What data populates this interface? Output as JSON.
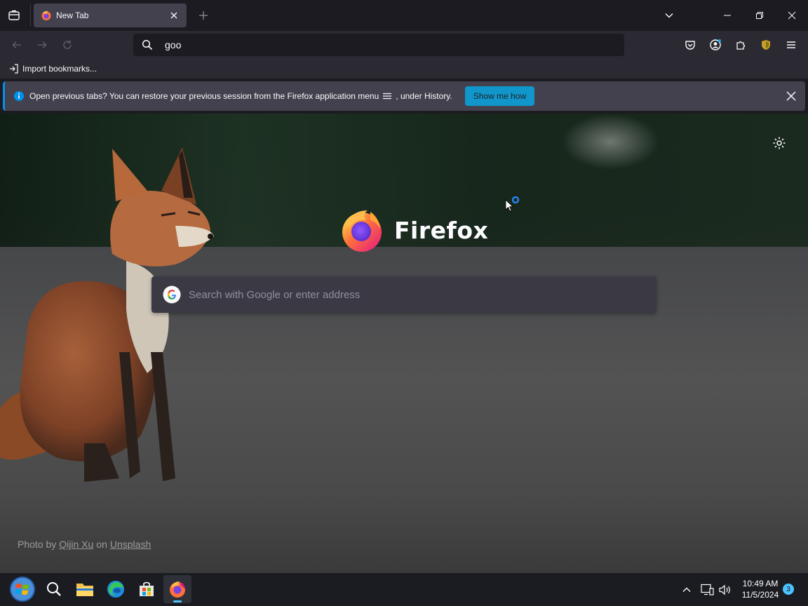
{
  "browser": {
    "tab": {
      "title": "New Tab"
    },
    "urlbar": {
      "text": "goo"
    },
    "bookmarks": {
      "import_label": "Import bookmarks..."
    },
    "notification": {
      "message_part1": "Open previous tabs? You can restore your previous session from the Firefox application menu",
      "message_part2": ", under History.",
      "button_label": "Show me how"
    }
  },
  "newtab": {
    "wordmark": "Firefox",
    "search_placeholder": "Search with Google or enter address",
    "credit": {
      "prefix": "Photo by",
      "author": "Qijin Xu",
      "on": "on",
      "site": "Unsplash"
    }
  },
  "taskbar": {
    "time": "10:49 AM",
    "date": "11/5/2024",
    "notification_count": "3"
  },
  "colors": {
    "accent": "#00b3f4",
    "toolbar_bg": "#2b2a33",
    "tabstrip_bg": "#1c1b22"
  }
}
